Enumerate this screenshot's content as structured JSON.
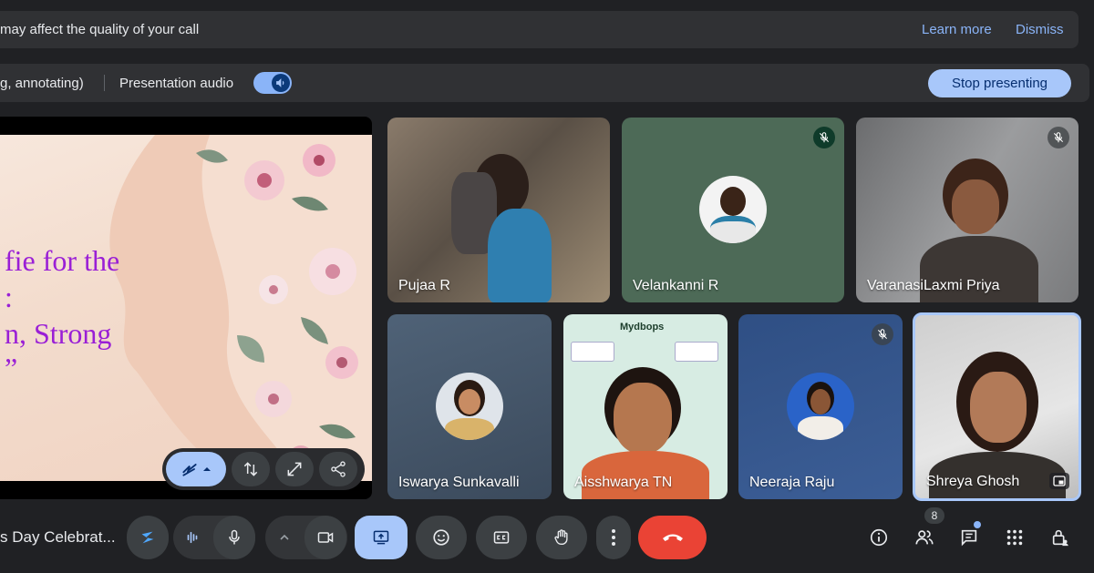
{
  "banner": {
    "message": "may affect the quality of your call",
    "learn_more": "Learn more",
    "dismiss": "Dismiss"
  },
  "presentation_bar": {
    "partial_text": "g, annotating)",
    "audio_label": "Presentation audio",
    "stop_label": "Stop presenting"
  },
  "slide": {
    "lines": [
      "fie for the",
      ":",
      "n, Strong",
      "”"
    ],
    "text_color": "#9a1fd6"
  },
  "participants": [
    {
      "name": "Pujaa R",
      "muted": false
    },
    {
      "name": "Velankanni R",
      "muted": true
    },
    {
      "name": "VaranasiLaxmi Priya",
      "muted": true
    },
    {
      "name": "Iswarya Sunkavalli",
      "muted": false
    },
    {
      "name": "Aisshwarya TN",
      "muted": false,
      "background_brand": "Mydbops"
    },
    {
      "name": "Neeraja Raju",
      "muted": true
    },
    {
      "name": "Shreya Ghosh",
      "muted": false,
      "active": true
    }
  ],
  "controls": {
    "meeting_name": "s Day Celebrat...",
    "people_count": "8"
  },
  "colors": {
    "background": "#202124",
    "surface": "#303134",
    "accent": "#8ab4f8",
    "stop_button": "#a8c7fa",
    "end_call": "#ea4335",
    "active_outline": "#a8c7fa"
  }
}
